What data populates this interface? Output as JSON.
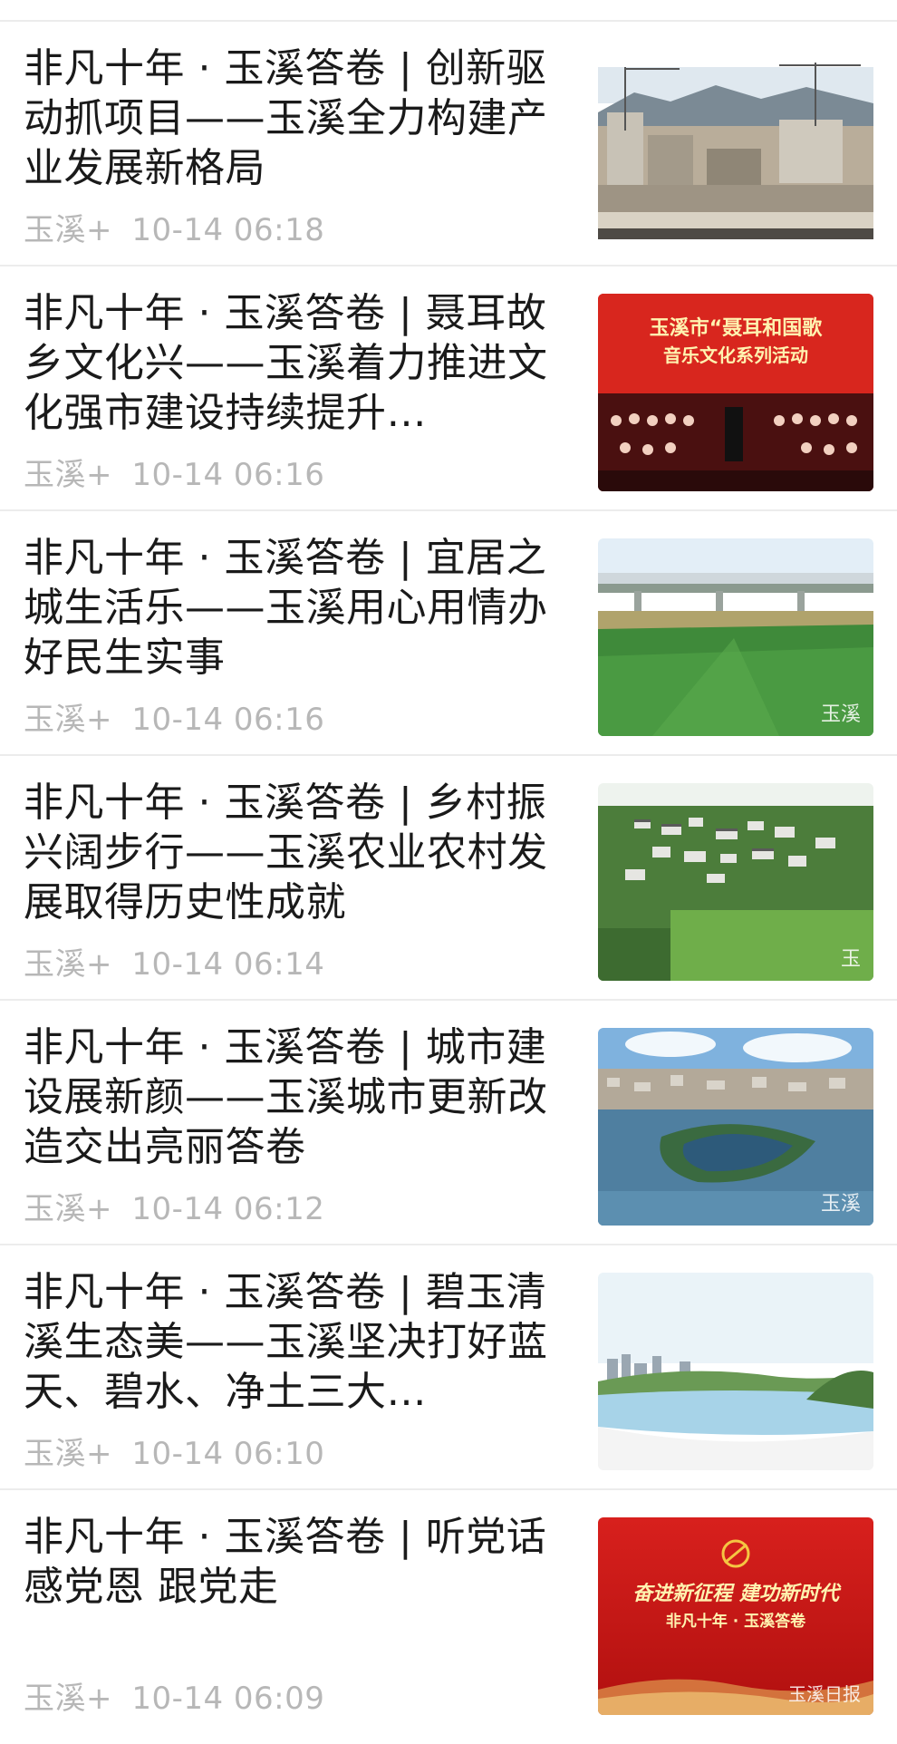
{
  "feed": {
    "items": [
      {
        "title": "非凡十年 · 玉溪答卷 | 创新驱动抓项目——玉溪全力构建产业发展新格局",
        "source": "玉溪+",
        "time": "10-14 06:18",
        "thumb": "construction-site-photo"
      },
      {
        "title": "非凡十年 · 玉溪答卷 | 聂耳故乡文化兴——玉溪着力推进文化强市建设持续提升…",
        "source": "玉溪+",
        "time": "10-14 06:16",
        "thumb": "concert-stage-photo",
        "thumb_text": [
          "玉溪市“聂耳和国歌",
          "音乐文化系列活动"
        ]
      },
      {
        "title": "非凡十年 · 玉溪答卷 | 宜居之城生活乐——玉溪用心用情办好民生实事",
        "source": "玉溪+",
        "time": "10-14 06:16",
        "thumb": "lotus-field-bridge-photo",
        "thumb_watermark": "玉溪"
      },
      {
        "title": "非凡十年 · 玉溪答卷 | 乡村振兴阔步行——玉溪农业农村发展取得历史性成就",
        "source": "玉溪+",
        "time": "10-14 06:14",
        "thumb": "village-aerial-photo",
        "thumb_watermark": "玉"
      },
      {
        "title": "非凡十年 · 玉溪答卷 | 城市建设展新颜——玉溪城市更新改造交出亮丽答卷",
        "source": "玉溪+",
        "time": "10-14 06:12",
        "thumb": "city-lake-aerial-photo",
        "thumb_watermark": "玉溪"
      },
      {
        "title": "非凡十年 · 玉溪答卷 | 碧玉清溪生态美——玉溪坚决打好蓝天、碧水、净土三大…",
        "source": "玉溪+",
        "time": "10-14 06:10",
        "thumb": "river-landscape-painting"
      },
      {
        "title": "非凡十年 · 玉溪答卷 | 听党话 感党恩 跟党走",
        "source": "玉溪+",
        "time": "10-14 06:09",
        "thumb": "red-party-poster",
        "thumb_text": [
          "奋进新征程 建功新时代",
          "非凡十年 · 玉溪答卷"
        ],
        "thumb_watermark": "玉溪日报"
      }
    ]
  }
}
